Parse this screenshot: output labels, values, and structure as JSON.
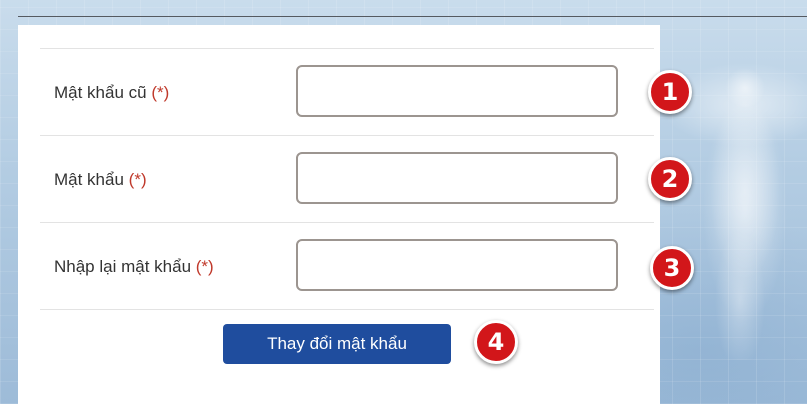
{
  "form": {
    "fields": [
      {
        "label": "Mật khẩu cũ",
        "required_mark": "(*)",
        "value": "",
        "placeholder": ""
      },
      {
        "label": "Mật khẩu",
        "required_mark": "(*)",
        "value": "",
        "placeholder": ""
      },
      {
        "label": "Nhập lại mật khẩu",
        "required_mark": "(*)",
        "value": "",
        "placeholder": ""
      }
    ],
    "submit_label": "Thay đổi mật khẩu"
  },
  "step_badges": [
    "1",
    "2",
    "3",
    "4"
  ],
  "colors": {
    "button_bg": "#1f4d9e",
    "badge_bg": "#d2161a",
    "required": "#c0392b"
  }
}
